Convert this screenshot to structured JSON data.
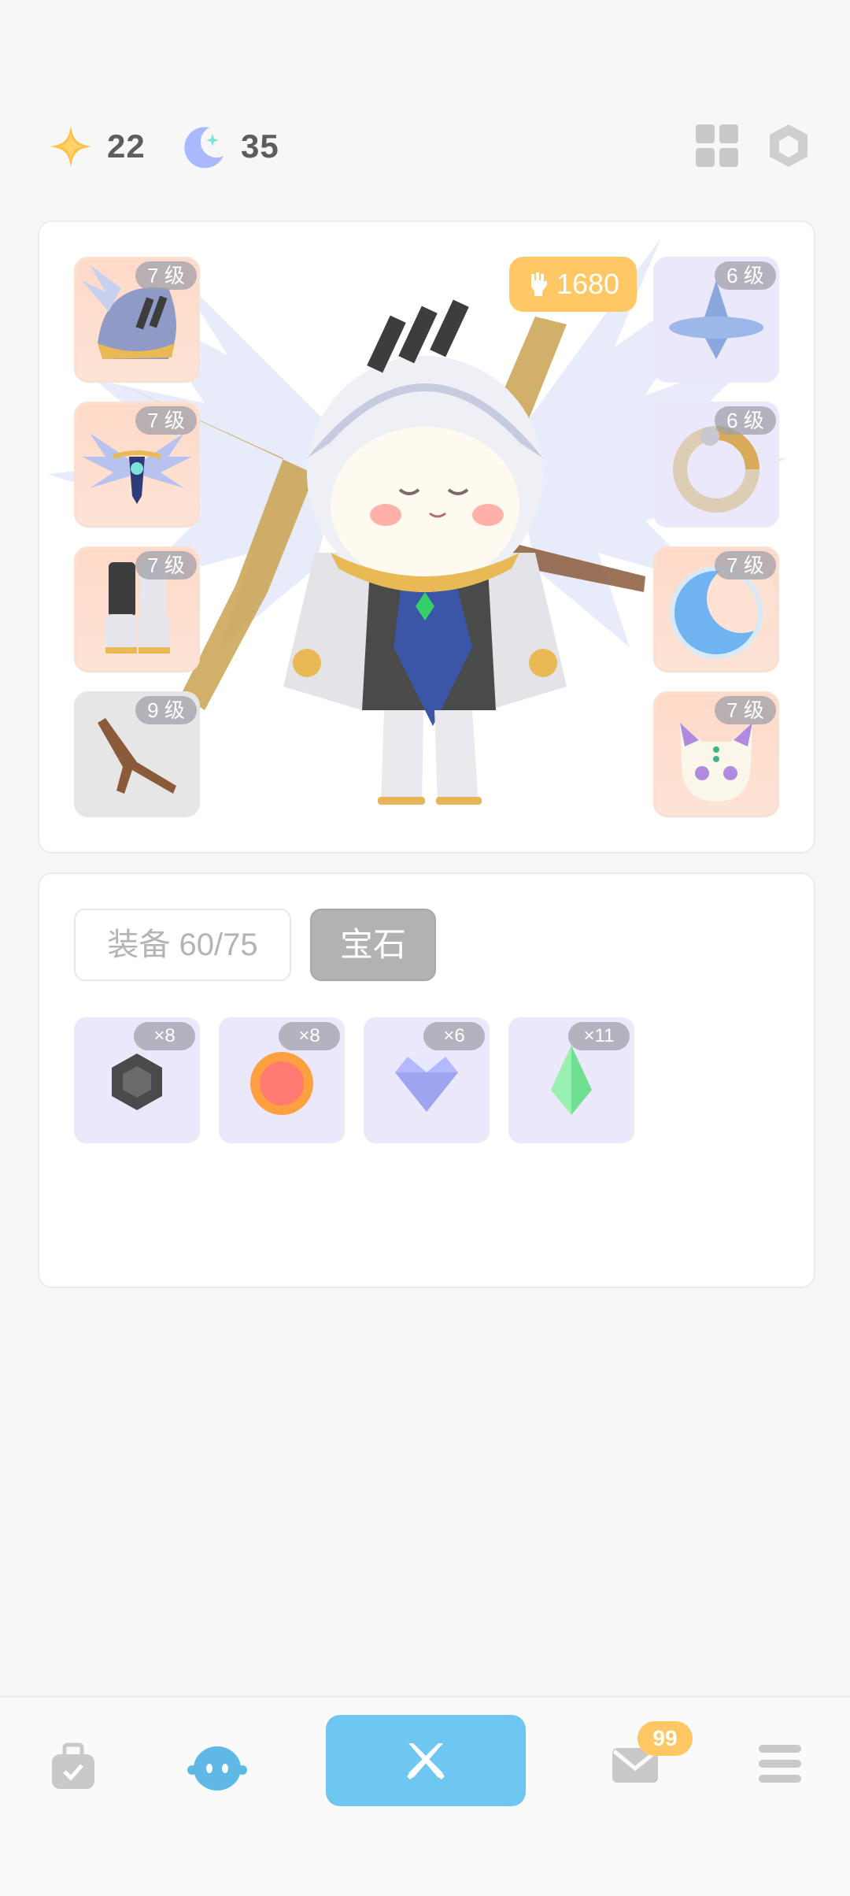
{
  "currencies": [
    {
      "icon": "star-sparkle-icon",
      "value": "22"
    },
    {
      "icon": "crescent-moon-icon",
      "value": "35"
    }
  ],
  "top_actions": [
    {
      "icon": "grid-icon"
    },
    {
      "icon": "hexagon-settings-icon"
    }
  ],
  "equipment": {
    "power_icon": "gauntlet-icon",
    "power": "1680",
    "left_slots": [
      {
        "item": "winged-helmet",
        "level": "7 级"
      },
      {
        "item": "winged-emblem",
        "level": "7 级"
      },
      {
        "item": "armored-boots",
        "level": "7 级"
      },
      {
        "item": "wooden-branch",
        "level": "9 级"
      }
    ],
    "right_slots": [
      {
        "item": "spinning-top",
        "level": "6 级"
      },
      {
        "item": "dragon-ring",
        "level": "6 级"
      },
      {
        "item": "moon-shield",
        "level": "7 级"
      },
      {
        "item": "cat-pet",
        "level": "7 级"
      }
    ]
  },
  "inventory": {
    "tabs": [
      {
        "label": "装备 60/75",
        "active": false
      },
      {
        "label": "宝石",
        "active": true
      }
    ],
    "gems": [
      {
        "icon": "black-hexagon-gem-icon",
        "qty": "×8"
      },
      {
        "icon": "orange-orb-gem-icon",
        "qty": "×8"
      },
      {
        "icon": "diamond-gem-icon",
        "qty": "×6"
      },
      {
        "icon": "green-crystal-gem-icon",
        "qty": "×11"
      }
    ]
  },
  "nav": {
    "items": [
      {
        "icon": "bag-icon"
      },
      {
        "icon": "character-icon",
        "active": true
      },
      {
        "icon": "crossed-swords-icon"
      },
      {
        "icon": "mail-icon",
        "badge": "99"
      },
      {
        "icon": "menu-icon"
      }
    ]
  },
  "colors": {
    "accent_blue": "#6ec7f0",
    "badge_gold": "#ffc864",
    "slot_peach": "#ffd9c8",
    "slot_lavender": "#ece8fb"
  }
}
